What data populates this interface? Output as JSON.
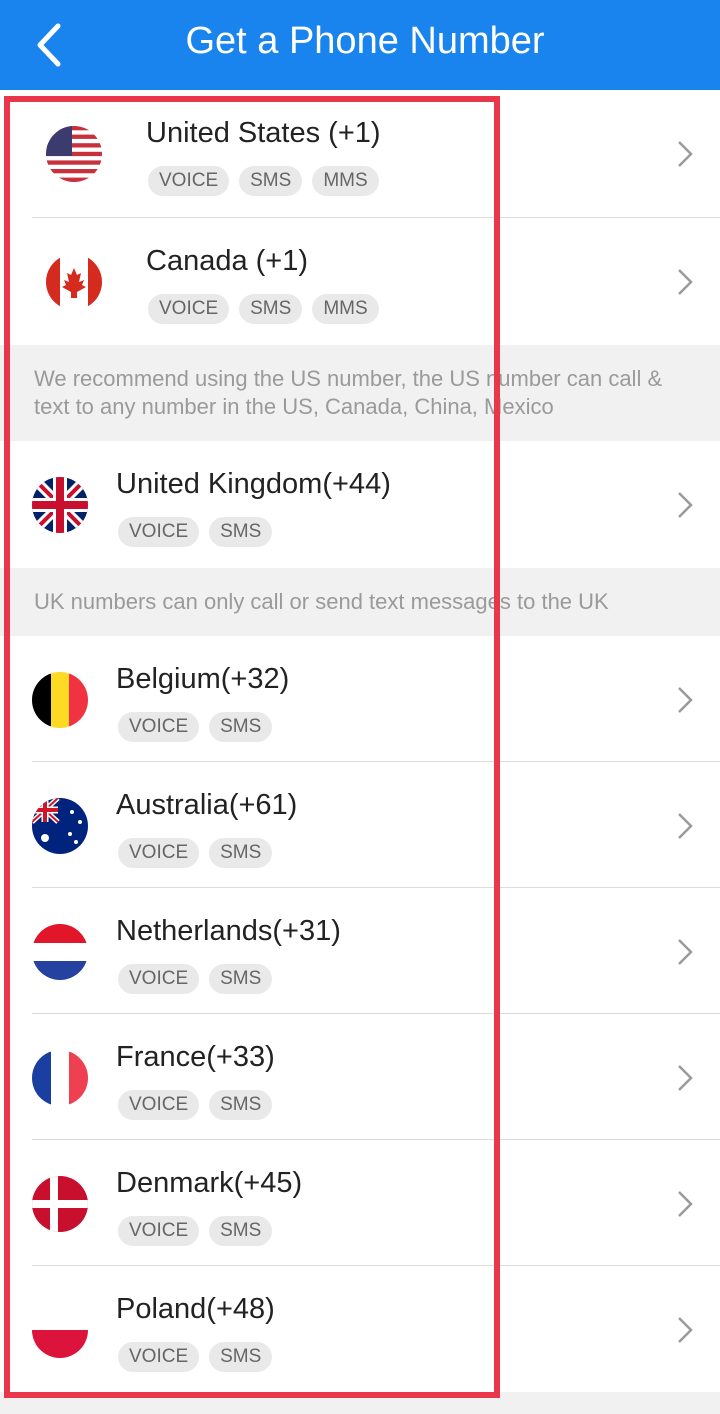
{
  "header": {
    "title": "Get a Phone Number",
    "back_icon": "chevron-left-icon"
  },
  "countries_a": [
    {
      "key": "us",
      "name": "United States (+1)",
      "tags": [
        "VOICE",
        "SMS",
        "MMS"
      ]
    },
    {
      "key": "ca",
      "name": "Canada (+1)",
      "tags": [
        "VOICE",
        "SMS",
        "MMS"
      ]
    }
  ],
  "note_us": "We recommend using the US number, the US number can call & text to any number in the US, Canada, China, Mexico",
  "countries_b": [
    {
      "key": "uk",
      "name": "United Kingdom(+44)",
      "tags": [
        "VOICE",
        "SMS"
      ]
    }
  ],
  "note_uk": "UK numbers can only call or send text messages to the UK",
  "countries_c": [
    {
      "key": "be",
      "name": "Belgium(+32)",
      "tags": [
        "VOICE",
        "SMS"
      ]
    },
    {
      "key": "au",
      "name": "Australia(+61)",
      "tags": [
        "VOICE",
        "SMS"
      ]
    },
    {
      "key": "nl",
      "name": "Netherlands(+31)",
      "tags": [
        "VOICE",
        "SMS"
      ]
    },
    {
      "key": "fr",
      "name": "France(+33)",
      "tags": [
        "VOICE",
        "SMS"
      ]
    },
    {
      "key": "dk",
      "name": "Denmark(+45)",
      "tags": [
        "VOICE",
        "SMS"
      ]
    },
    {
      "key": "pl",
      "name": "Poland(+48)",
      "tags": [
        "VOICE",
        "SMS"
      ]
    }
  ],
  "colors": {
    "appbar": "#1a84ee",
    "highlight_border": "#e8374b",
    "tag_bg": "#e9e9e9",
    "tag_text": "#666666"
  }
}
